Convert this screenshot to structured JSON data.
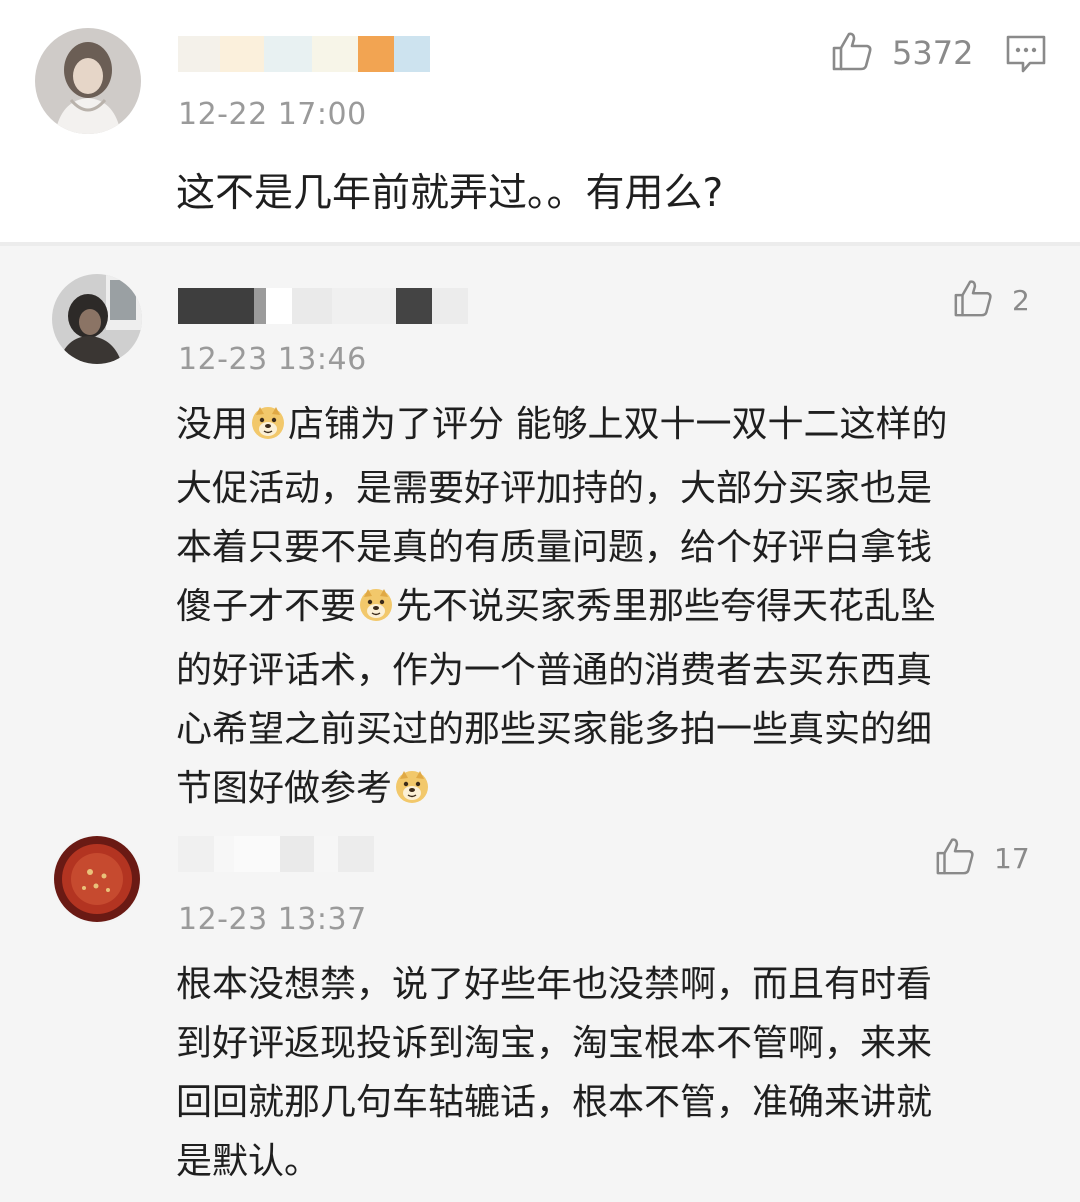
{
  "main_comment": {
    "time": "12-22 17:00",
    "likes": "5372",
    "text": "这不是几年前就弄过。。有用么?"
  },
  "replies": [
    {
      "time": "12-23 13:46",
      "likes": "2",
      "lines": [
        [
          "没用",
          "[doge]",
          "店铺为了评分 能够上双十一双十二这样的"
        ],
        [
          "大促活动，是需要好评加持的，大部分买家也是"
        ],
        [
          "本着只要不是真的有质量问题，给个好评白拿钱"
        ],
        [
          "傻子才不要",
          "[doge]",
          "先不说买家秀里那些夸得天花乱坠"
        ],
        [
          "的好评话术，作为一个普通的消费者去买东西真"
        ],
        [
          "心希望之前买过的那些买家能多拍一些真实的细"
        ],
        [
          "节图好做参考",
          "[doge]"
        ]
      ]
    },
    {
      "time": "12-23 13:37",
      "likes": "17",
      "lines": [
        [
          "根本没想禁，说了好些年也没禁啊，而且有时看"
        ],
        [
          "到好评返现投诉到淘宝，淘宝根本不管啊，来来"
        ],
        [
          "回回就那几句车轱辘话，根本不管，准确来讲就"
        ],
        [
          "是默认。"
        ]
      ]
    }
  ],
  "icons": {
    "like": "thumbs-up-icon",
    "comment": "comment-icon",
    "emoji": "doge-emoji-icon"
  },
  "colors": {
    "time": "#9a9a9a",
    "text": "#1f1f1f",
    "reply_bg": "#f5f5f5"
  }
}
